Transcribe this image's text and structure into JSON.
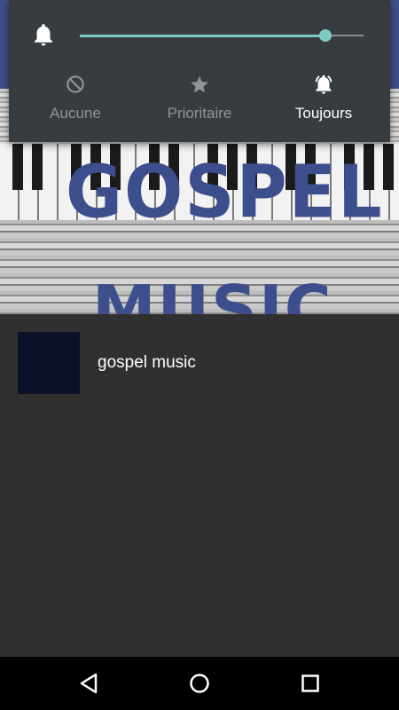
{
  "banner": {
    "line1": "GOSPEL",
    "line2": "MUSIC",
    "accent_color": "#3d4e8c"
  },
  "volume_panel": {
    "icon": "bell-icon",
    "level": 0.865,
    "accent_color": "#80cbc4",
    "modes": [
      {
        "label": "Aucune",
        "icon": "block-icon",
        "active": false
      },
      {
        "label": "Prioritaire",
        "icon": "star-icon",
        "active": false
      },
      {
        "label": "Toujours",
        "icon": "bell-ringing-icon",
        "active": true
      }
    ]
  },
  "list": {
    "items": [
      {
        "title": "gospel music",
        "thumb_color": "#0c1129"
      }
    ]
  },
  "navbar": {
    "buttons": [
      "back-icon",
      "home-icon",
      "recents-icon"
    ]
  }
}
